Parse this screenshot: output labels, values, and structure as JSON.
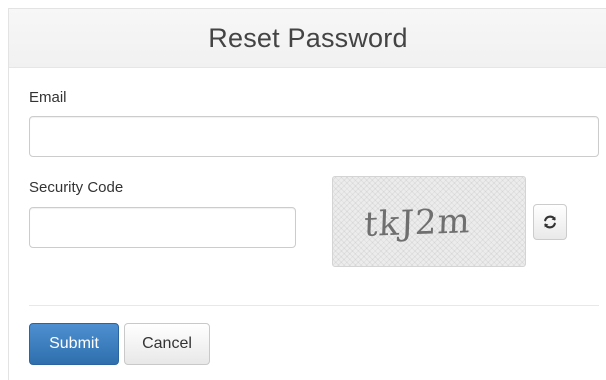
{
  "header": {
    "title": "Reset Password"
  },
  "form": {
    "email": {
      "label": "Email",
      "value": "",
      "placeholder": ""
    },
    "security_code": {
      "label": "Security Code",
      "value": "",
      "placeholder": ""
    },
    "captcha": {
      "text": "tkJ2m"
    },
    "refresh_icon": "refresh-icon"
  },
  "actions": {
    "submit_label": "Submit",
    "cancel_label": "Cancel"
  },
  "colors": {
    "primary": "#3a7bbf",
    "header_bg": "#f4f4f4",
    "border": "#cccccc"
  }
}
